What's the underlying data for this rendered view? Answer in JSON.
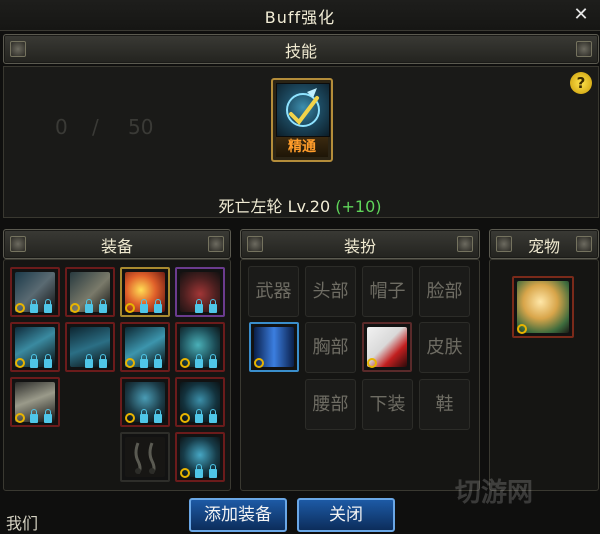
{
  "window": {
    "title": "Buff强化",
    "close_glyph": "✕"
  },
  "skill_section": {
    "header": "技能",
    "faint_counter": [
      "0",
      "/",
      "50"
    ],
    "mastery_label": "精通",
    "skill_name": "死亡左轮",
    "level": "Lv.20",
    "bonus": "(+10)",
    "help_glyph": "?"
  },
  "equipment": {
    "header": "装备",
    "slot_count": 14
  },
  "avatar": {
    "header": "装扮",
    "cells": [
      "武器",
      "头部",
      "帽子",
      "脸部",
      "",
      "胸部",
      "",
      "皮肤",
      "腰部",
      "下装",
      "鞋"
    ]
  },
  "pet": {
    "header": "宠物"
  },
  "buttons": {
    "add": "添加装备",
    "close": "关闭"
  },
  "bottom_text": "我们",
  "watermark": "切游网",
  "colors": {
    "accent_green": "#5fd65a",
    "mastery_orange": "#ff9c2a",
    "button_blue": "#1d5aa5"
  }
}
